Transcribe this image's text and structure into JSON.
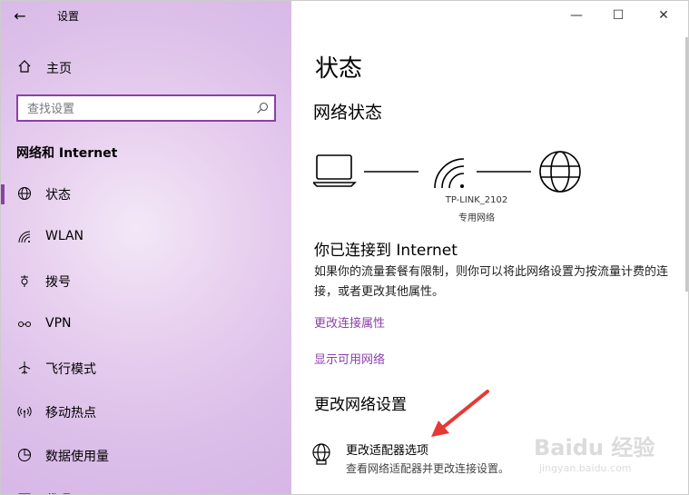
{
  "window": {
    "app_title": "设置",
    "controls": {
      "minimize": "—",
      "maximize": "☐",
      "close": "✕"
    }
  },
  "sidebar": {
    "home_label": "主页",
    "search": {
      "placeholder": "查找设置",
      "value": ""
    },
    "section_title": "网络和 Internet",
    "items": [
      {
        "label": "状态",
        "icon": "globe-icon",
        "active": true
      },
      {
        "label": "WLAN",
        "icon": "wifi-icon",
        "active": false
      },
      {
        "label": "拨号",
        "icon": "dialup-icon",
        "active": false
      },
      {
        "label": "VPN",
        "icon": "vpn-icon",
        "active": false
      },
      {
        "label": "飞行模式",
        "icon": "airplane-icon",
        "active": false
      },
      {
        "label": "移动热点",
        "icon": "hotspot-icon",
        "active": false
      },
      {
        "label": "数据使用量",
        "icon": "data-usage-icon",
        "active": false
      },
      {
        "label": "代理",
        "icon": "proxy-icon",
        "active": false
      }
    ]
  },
  "main": {
    "page_title": "状态",
    "network_status_title": "网络状态",
    "network": {
      "ssid": "TP-LINK_2102",
      "type": "专用网络"
    },
    "connected_title": "你已连接到 Internet",
    "connected_desc": "如果你的流量套餐有限制，则你可以将此网络设置为按流量计费的连接，或者更改其他属性。",
    "links": {
      "change_properties": "更改连接属性",
      "show_networks": "显示可用网络"
    },
    "change_settings_title": "更改网络设置",
    "adapter_option": {
      "title": "更改适配器选项",
      "desc": "查看网络适配器并更改连接设置。"
    }
  },
  "watermark": {
    "brand": "Baidu 经验",
    "url": "jingyan.baidu.com"
  },
  "colors": {
    "accent": "#8b40a8",
    "annotation_arrow": "#e53935"
  }
}
